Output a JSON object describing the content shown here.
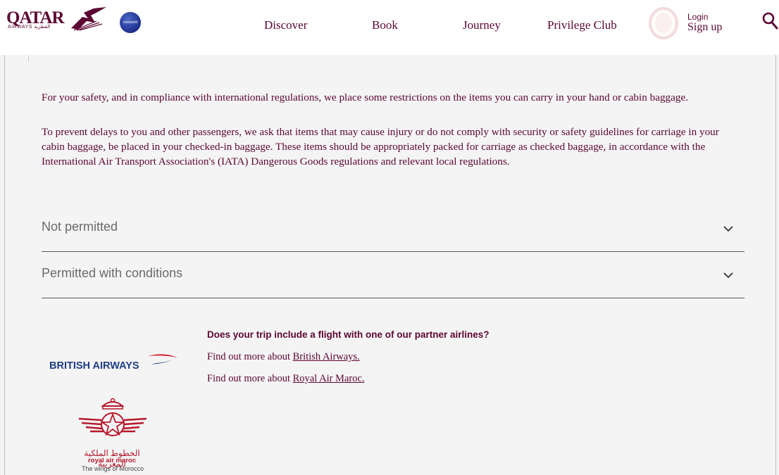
{
  "header": {
    "logo_text": "QATAR",
    "logo_sub": "AIRWAYS القطرية",
    "alliance_badge": "oneworld",
    "nav": [
      "Discover",
      "Book",
      "Journey",
      "Privilege Club"
    ],
    "login_label": "Login",
    "signup_label": "Sign up",
    "icons": [
      "oryx-logo-icon",
      "avatar-icon",
      "search-icon"
    ]
  },
  "content": {
    "paragraphs": [
      "For your safety, and in compliance with international regulations, we place some restrictions on the items you can carry in your hand or cabin baggage.",
      "To prevent delays to you and other passengers, we ask that items that may cause injury or do not comply with security or safety guidelines for carriage in your cabin baggage, be placed in your checked-in baggage. These items should be appropriately packed for carriage as checked baggage, in accordance with the International Air Transport Association's (IATA) Dangerous Goods regulations and relevant local regulations."
    ],
    "accordion": [
      {
        "label": "Not permitted",
        "icon": "chevron-down-icon"
      },
      {
        "label": "Permitted with conditions",
        "icon": "chevron-down-icon"
      }
    ]
  },
  "partners": {
    "question": "Does your trip include a flight with one of our partner airlines?",
    "lines": [
      {
        "prefix": "Find out more about ",
        "link": "British Airways."
      },
      {
        "prefix": "Find out more about ",
        "link": "Royal Air Maroc."
      }
    ],
    "ba_logo_text": "BRITISH AIRWAYS",
    "ram_arabic": "الخطوط الملكية المغربية",
    "ram_latin": "royal air maroc",
    "ram_tagline": "The wings of Morocco"
  },
  "colors": {
    "brand_maroon": "#5c0632",
    "page_bg": "#f4f4f4",
    "ba_blue": "#1e3e86",
    "ram_red": "#b8172b"
  }
}
